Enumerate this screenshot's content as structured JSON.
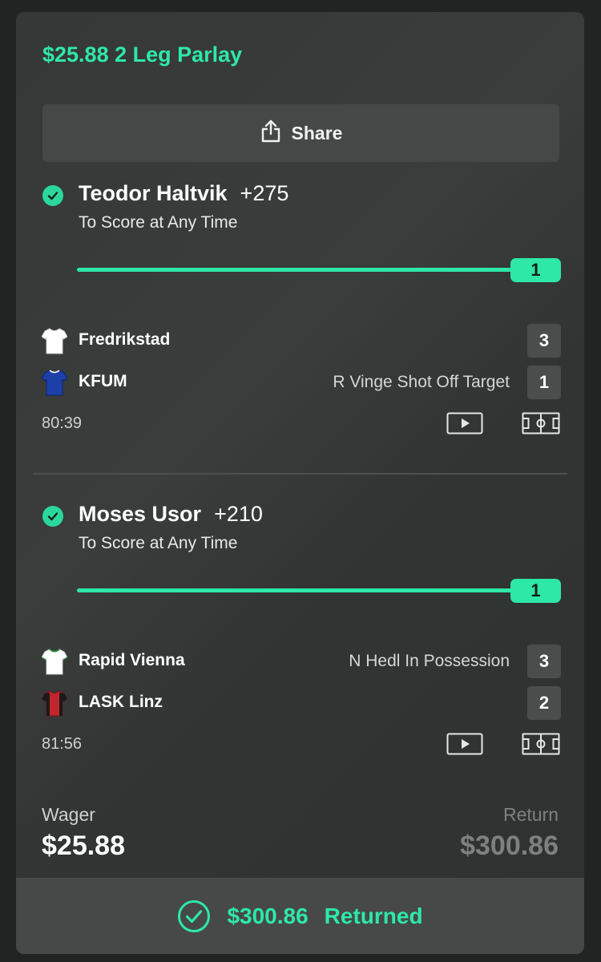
{
  "header": {
    "title": "$25.88 2 Leg Parlay"
  },
  "share": {
    "label": "Share",
    "icon": "share-icon"
  },
  "colors": {
    "accent": "#2ee8a8",
    "background": "#222423",
    "card": "#353837"
  },
  "legs": [
    {
      "status_icon": "check-circle-icon",
      "player": "Teodor Haltvik",
      "odds": "+275",
      "market": "To Score at Any Time",
      "progress": {
        "value": 1,
        "fill_fraction": 1.0,
        "label": "1"
      },
      "teams": [
        {
          "name": "Fredrikstad",
          "jersey": "jersey-icon",
          "jersey_color": "#ffffff",
          "event": "",
          "score": "3"
        },
        {
          "name": "KFUM",
          "jersey": "jersey-icon",
          "jersey_color": "#1d3fa8",
          "event": "R Vinge Shot Off Target",
          "score": "1"
        }
      ],
      "clock": "80:39"
    },
    {
      "status_icon": "check-circle-icon",
      "player": "Moses Usor",
      "odds": "+210",
      "market": "To Score at Any Time",
      "progress": {
        "value": 1,
        "fill_fraction": 1.0,
        "label": "1"
      },
      "teams": [
        {
          "name": "Rapid Vienna",
          "jersey": "jersey-icon",
          "jersey_color": "#ffffff",
          "event": "N Hedl In Possession",
          "score": "3"
        },
        {
          "name": "LASK Linz",
          "jersey": "jersey-icon",
          "jersey_color": "#c2262c",
          "event": "",
          "score": "2"
        }
      ],
      "clock": "81:56"
    }
  ],
  "footer": {
    "wager_label": "Wager",
    "wager_value": "$25.88",
    "return_label": "Return",
    "return_value": "$300.86",
    "returned_amount": "$300.86",
    "returned_label": "Returned"
  }
}
